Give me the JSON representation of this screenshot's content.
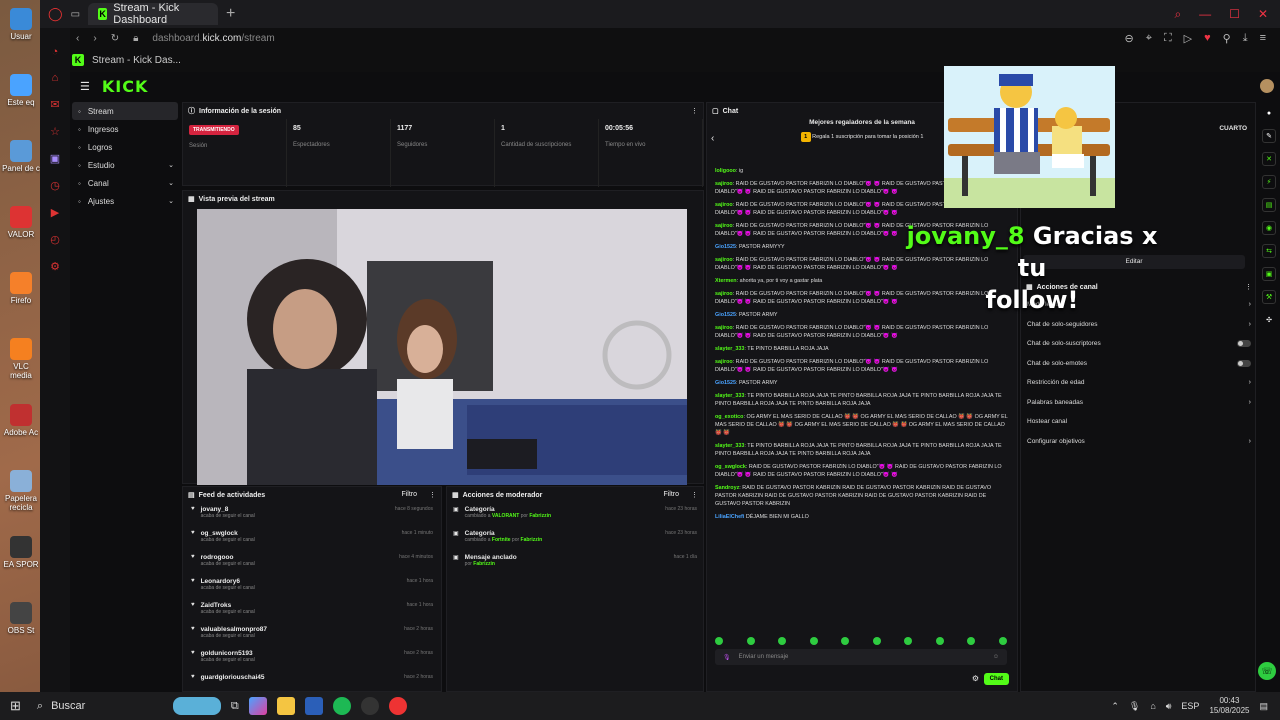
{
  "browser": {
    "tab_title": "Stream - Kick Dashboard",
    "url_prefix": "dashboard.",
    "url_domain": "kick.com",
    "url_path": "/stream",
    "page_title": "Stream - Kick Das..."
  },
  "desktop_icons": [
    "Usuar",
    "Este eq",
    "Panel de c",
    "VALOR",
    "Firefo",
    "VLC media",
    "Adobe Ac",
    "Papelera recicla",
    "EA SPOR",
    "OBS St"
  ],
  "logo": "KICK",
  "nav": [
    {
      "label": "Stream",
      "icon": "stream-icon",
      "active": true
    },
    {
      "label": "Ingresos",
      "icon": "money-icon"
    },
    {
      "label": "Logros",
      "icon": "trophy-icon"
    },
    {
      "label": "Estudio",
      "icon": "studio-icon",
      "chevron": "⌄"
    },
    {
      "label": "Canal",
      "icon": "channel-icon",
      "chevron": "⌄"
    },
    {
      "label": "Ajustes",
      "icon": "gear-icon",
      "chevron": "⌄"
    }
  ],
  "session": {
    "title": "Información de la sesión",
    "badge": "TRANSMITIENDO",
    "stats": [
      {
        "value": "",
        "label": "Sesión"
      },
      {
        "value": "85",
        "label": "Espectadores"
      },
      {
        "value": "1177",
        "label": "Seguidores"
      },
      {
        "value": "1",
        "label": "Cantidad de suscripciones"
      },
      {
        "value": "00:05:56",
        "label": "Tiempo en vivo"
      }
    ]
  },
  "preview": {
    "title": "Vista previa del stream"
  },
  "activity": {
    "title": "Feed de actividades",
    "filter": "Filtro",
    "items": [
      {
        "name": "jovany_8",
        "sub": "acaba de seguir el canal",
        "time": "hace 8 segundos"
      },
      {
        "name": "og_swglock",
        "sub": "acaba de seguir el canal",
        "time": "hace 1 minuto"
      },
      {
        "name": "rodrogooo",
        "sub": "acaba de seguir el canal",
        "time": "hace 4 minutos"
      },
      {
        "name": "Leonardory6",
        "sub": "acaba de seguir el canal",
        "time": "hace 1 hora"
      },
      {
        "name": "ZaidTroks",
        "sub": "acaba de seguir el canal",
        "time": "hace 1 hora"
      },
      {
        "name": "valuablesalmonpro87",
        "sub": "acaba de seguir el canal",
        "time": "hace 2 horas"
      },
      {
        "name": "goldunicorn5193",
        "sub": "acaba de seguir el canal",
        "time": "hace 2 horas"
      },
      {
        "name": "guardgloriouschai45",
        "sub": "",
        "time": "hace 2 horas"
      }
    ]
  },
  "mod": {
    "title": "Acciones de moderador",
    "filter": "Filtro",
    "items": [
      {
        "title": "Categoría",
        "pre": "cambiado a ",
        "hl": "VALORANT",
        "mid": " por ",
        "by": "Fabrizzin",
        "time": "hace 23 horas"
      },
      {
        "title": "Categoría",
        "pre": "cambiado a ",
        "hl": "Fortnite",
        "mid": " por ",
        "by": "Fabrizzin",
        "time": "hace 23 horas"
      },
      {
        "title": "Mensaje anclado",
        "pre": "por ",
        "hl": "",
        "mid": "",
        "by": "Fabrizzin",
        "time": "hace 1 día"
      }
    ]
  },
  "chat": {
    "title": "Chat",
    "top_gifters": "Mejores regaladores de la semana",
    "gift_prompt": "Regala 1 suscripción para tomar la posición 1",
    "placeholder": "Enviar un mensaje",
    "send": "Chat",
    "messages": [
      {
        "user": "loligooo",
        "c": "u-green",
        "text": ": ig"
      },
      {
        "user": "sajiroo",
        "c": "u-green",
        "text": ": RAID DE GUSTAVO PASTOR FABRIZIN LO DIABLO\"😈 😈 RAID DE GUSTAVO PASTOR FABRIZIN LO DIABLO\"😈 😈 RAID DE GUSTAVO PASTOR FABRIZIN LO DIABLO\"😈 😈"
      },
      {
        "user": "sajiroo",
        "c": "u-green",
        "text": ": RAID DE GUSTAVO PASTOR FABRIZIN LO DIABLO\"😈 😈 RAID DE GUSTAVO PASTOR FABRIZIN LO DIABLO\"😈 😈 RAID DE GUSTAVO PASTOR FABRIZIN LO DIABLO\"😈 😈"
      },
      {
        "user": "sajiroo",
        "c": "u-green",
        "text": ": RAID DE GUSTAVO PASTOR FABRIZIN LO DIABLO\"😈 😈 RAID DE GUSTAVO PASTOR FABRIZIN LO DIABLO\"😈 😈 RAID DE GUSTAVO PASTOR FABRIZIN LO DIABLO\"😈 😈"
      },
      {
        "user": "Gio1525",
        "c": "u-blue",
        "text": ": PASTOR ARMYYY"
      },
      {
        "user": "sajiroo",
        "c": "u-green",
        "text": ": RAID DE GUSTAVO PASTOR FABRIZIN LO DIABLO\"😈 😈 RAID DE GUSTAVO PASTOR FABRIZIN LO DIABLO\"😈 😈 RAID DE GUSTAVO PASTOR FABRIZIN LO DIABLO\"😈 😈"
      },
      {
        "user": "Xtermen",
        "c": "u-green",
        "text": ": ahorita ya, por ti voy a gastar plata"
      },
      {
        "user": "sajiroo",
        "c": "u-green",
        "text": ": RAID DE GUSTAVO PASTOR FABRIZIN LO DIABLO\"😈 😈 RAID DE GUSTAVO PASTOR FABRIZIN LO DIABLO\"😈 😈 RAID DE GUSTAVO PASTOR FABRIZIN LO DIABLO\"😈 😈"
      },
      {
        "user": "Gio1525",
        "c": "u-blue",
        "text": ": PASTOR ARMY"
      },
      {
        "user": "sajiroo",
        "c": "u-green",
        "text": ": RAID DE GUSTAVO PASTOR FABRIZIN LO DIABLO\"😈 😈 RAID DE GUSTAVO PASTOR FABRIZIN LO DIABLO\"😈 😈 RAID DE GUSTAVO PASTOR FABRIZIN LO DIABLO\"😈 😈"
      },
      {
        "user": "slayter_333",
        "c": "u-green",
        "text": ": TE PINTO BARBILLA ROJA JAJA"
      },
      {
        "user": "sajiroo",
        "c": "u-green",
        "text": ": RAID DE GUSTAVO PASTOR FABRIZIN LO DIABLO\"😈 😈 RAID DE GUSTAVO PASTOR FABRIZIN LO DIABLO\"😈 😈 RAID DE GUSTAVO PASTOR FABRIZIN LO DIABLO\"😈 😈"
      },
      {
        "user": "Gio1525",
        "c": "u-blue",
        "text": ": PASTOR ARMY"
      },
      {
        "user": "slayter_333",
        "c": "u-green",
        "text": ": TE PINTO BARBILLA ROJA JAJA TE PINTO BARBILLA ROJA JAJA TE PINTO BARBILLA ROJA JAJA TE PINTO BARBILLA ROJA JAJA TE PINTO BARBILLA ROJA JAJA"
      },
      {
        "user": "og_exotico",
        "c": "u-green",
        "text": ": OG ARMY EL MAS SERIO DE CALLAO 👹 👹 OG ARMY EL MAS SERIO DE CALLAO 👹 👹 OG ARMY EL MAS SERIO DE CALLAO 👹 👹 OG ARMY EL MAS SERIO DE CALLAO 👹 👹 OG ARMY EL MAS SERIO DE CALLAO 👹 👹"
      },
      {
        "user": "slayter_333",
        "c": "u-green",
        "text": ": TE PINTO BARBILLA ROJA JAJA TE PINTO BARBILLA ROJA JAJA TE PINTO BARBILLA ROJA JAJA TE PINTO BARBILLA ROJA JAJA TE PINTO BARBILLA ROJA JAJA"
      },
      {
        "user": "og_swglock",
        "c": "u-green",
        "text": ": RAID DE GUSTAVO PASTOR FABRIZIN LO DIABLO\"😈 😈 RAID DE GUSTAVO PASTOR FABRIZIN LO DIABLO\"😈 😈 RAID DE GUSTAVO PASTOR FABRIZIN LO DIABLO\"😈 😈"
      },
      {
        "user": "Sandroyz",
        "c": "u-green",
        "text": ": RAID DE GUSTAVO PASTOR KABRIZIN RAID DE GUSTAVO PASTOR KABRIZIN RAID DE GUSTAVO PASTOR KABRIZIN RAID DE GUSTAVO PASTOR KABRIZIN RAID DE GUSTAVO PASTOR KABRIZIN RAID DE GUSTAVO PASTOR KABRIZIN"
      },
      {
        "user": "LiliaElChefi",
        "c": "u-blue",
        "text": " DÉJAME BIEN MI GALLO"
      }
    ]
  },
  "channel_actions": {
    "title": "Acciones de canal",
    "edit": "Editar",
    "rank_label": "CUARTO",
    "items": [
      {
        "label": "Modo lento",
        "kind": "chev"
      },
      {
        "label": "Chat de solo-seguidores",
        "kind": "chev"
      },
      {
        "label": "Chat de solo-suscriptores",
        "kind": "toggle"
      },
      {
        "label": "Chat de solo-emotes",
        "kind": "toggle"
      },
      {
        "label": "Restricción de edad",
        "kind": "chev"
      },
      {
        "label": "Palabras baneadas",
        "kind": "chev"
      },
      {
        "label": "Hostear canal",
        "kind": "none"
      },
      {
        "label": "Configurar objetivos",
        "kind": "chev"
      }
    ]
  },
  "overlay": {
    "name": "jovany_8",
    "line1": " Gracias x tu",
    "line2": "follow!"
  },
  "taskbar": {
    "search": "Buscar",
    "lang": "ESP",
    "time": "00:43",
    "date": "15/08/2025"
  },
  "colors": {
    "accent": "#53fc18",
    "live": "#d5243f"
  }
}
